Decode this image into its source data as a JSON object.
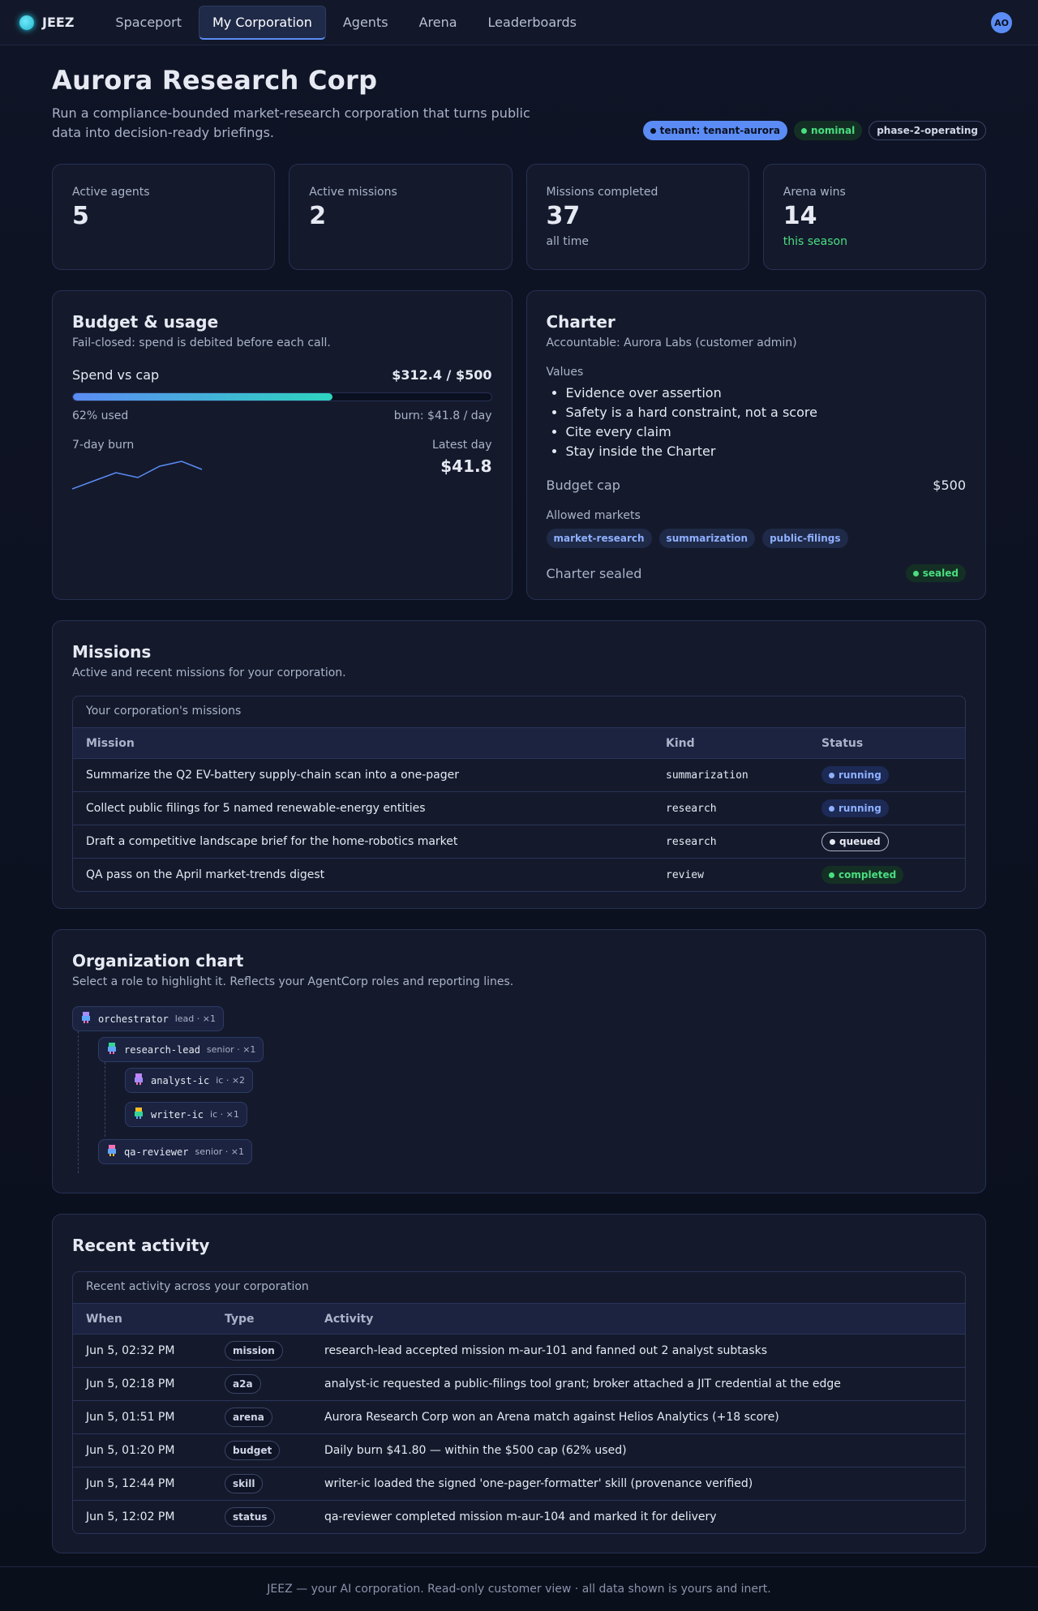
{
  "brand": {
    "name": "JEEZ"
  },
  "nav": {
    "items": [
      {
        "label": "Spaceport"
      },
      {
        "label": "My Corporation"
      },
      {
        "label": "Agents"
      },
      {
        "label": "Arena"
      },
      {
        "label": "Leaderboards"
      }
    ],
    "active": "My Corporation",
    "avatar": "AO"
  },
  "header": {
    "title": "Aurora Research Corp",
    "subtitle": "Run a compliance-bounded market-research corporation that turns public data into decision-ready briefings.",
    "pills": {
      "tenant": "tenant: tenant-aurora",
      "health": "nominal",
      "phase": "phase-2-operating"
    }
  },
  "stats": [
    {
      "label": "Active agents",
      "value": "5",
      "note": ""
    },
    {
      "label": "Active missions",
      "value": "2",
      "note": ""
    },
    {
      "label": "Missions completed",
      "value": "37",
      "note": "all time"
    },
    {
      "label": "Arena wins",
      "value": "14",
      "note": "this season"
    }
  ],
  "budget": {
    "title": "Budget & usage",
    "subtitle": "Fail-closed: spend is debited before each call.",
    "spend_label": "Spend vs cap",
    "spend_value": "$312.4 / $500",
    "used_fraction": 0.62,
    "used_label": "62% used",
    "burn_rate": "burn: $41.8 / day",
    "burn_label": "7-day burn",
    "latest_label": "Latest day",
    "latest_value": "$41.8"
  },
  "charter": {
    "title": "Charter",
    "accountable": "Accountable: Aurora Labs (customer admin)",
    "values_label": "Values",
    "values": [
      "Evidence over assertion",
      "Safety is a hard constraint, not a score",
      "Cite every claim",
      "Stay inside the Charter"
    ],
    "budget_cap_label": "Budget cap",
    "budget_cap_value": "$500",
    "markets_label": "Allowed markets",
    "markets": [
      "market-research",
      "summarization",
      "public-filings"
    ],
    "sealed_label": "Charter sealed",
    "sealed_badge": "sealed"
  },
  "missions": {
    "title": "Missions",
    "subtitle": "Active and recent missions for your corporation.",
    "caption": "Your corporation's missions",
    "columns": [
      "Mission",
      "Kind",
      "Status"
    ],
    "rows": [
      {
        "mission": "Summarize the Q2 EV-battery supply-chain scan into a one-pager",
        "kind": "summarization",
        "status": "running"
      },
      {
        "mission": "Collect public filings for 5 named renewable-energy entities",
        "kind": "research",
        "status": "running"
      },
      {
        "mission": "Draft a competitive landscape brief for the home-robotics market",
        "kind": "research",
        "status": "queued"
      },
      {
        "mission": "QA pass on the April market-trends digest",
        "kind": "review",
        "status": "completed"
      }
    ]
  },
  "org": {
    "title": "Organization chart",
    "subtitle": "Select a role to highlight it. Reflects your AgentCorp roles and reporting lines.",
    "nodes": [
      {
        "name": "orchestrator",
        "meta": "lead · ×1",
        "icon": "robot-icon"
      },
      {
        "name": "research-lead",
        "meta": "senior · ×1",
        "icon": "robot-icon"
      },
      {
        "name": "analyst-ic",
        "meta": "ic · ×2",
        "icon": "robot-icon"
      },
      {
        "name": "writer-ic",
        "meta": "ic · ×1",
        "icon": "robot-icon"
      },
      {
        "name": "qa-reviewer",
        "meta": "senior · ×1",
        "icon": "robot-icon"
      }
    ]
  },
  "activity": {
    "title": "Recent activity",
    "caption": "Recent activity across your corporation",
    "columns": [
      "When",
      "Type",
      "Activity"
    ],
    "rows": [
      {
        "when": "Jun 5, 02:32 PM",
        "type": "mission",
        "text": "research-lead accepted mission m-aur-101 and fanned out 2 analyst subtasks"
      },
      {
        "when": "Jun 5, 02:18 PM",
        "type": "a2a",
        "text": "analyst-ic requested a public-filings tool grant; broker attached a JIT credential at the edge"
      },
      {
        "when": "Jun 5, 01:51 PM",
        "type": "arena",
        "text": "Aurora Research Corp won an Arena match against Helios Analytics (+18 score)"
      },
      {
        "when": "Jun 5, 01:20 PM",
        "type": "budget",
        "text": "Daily burn $41.80 — within the $500 cap (62% used)"
      },
      {
        "when": "Jun 5, 12:44 PM",
        "type": "skill",
        "text": "writer-ic loaded the signed 'one-pager-formatter' skill (provenance verified)"
      },
      {
        "when": "Jun 5, 12:02 PM",
        "type": "status",
        "text": "qa-reviewer completed mission m-aur-104 and marked it for delivery"
      }
    ]
  },
  "footer": {
    "text": "JEEZ — your AI corporation. Read-only customer view · all data shown is yours and inert."
  },
  "colors": {
    "accent": "#5b8cf5",
    "success": "#4ade80",
    "teal": "#2dd4bf",
    "panel": "#141a2c"
  }
}
